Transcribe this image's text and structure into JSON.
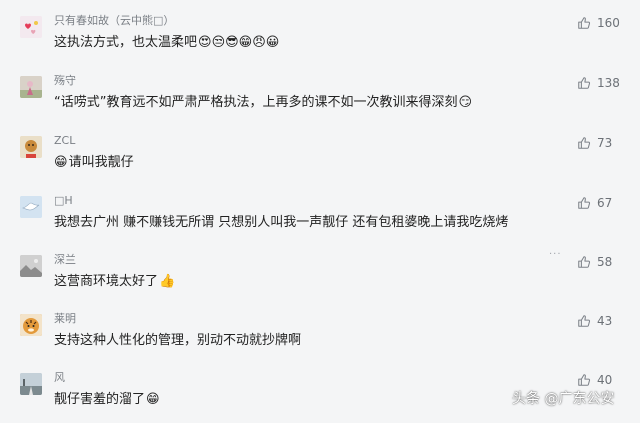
{
  "comments": [
    {
      "user": "只有春如故（云中熊□）",
      "text": "这执法方式，也太温柔吧",
      "emoji": "😍😒😎😁😠😀",
      "likes": "160",
      "avatar_icon": "avatar-hearts-icon",
      "avatar_color": "#f1e7ee"
    },
    {
      "user": "殇守",
      "text": "“话唠式”教育远不如严肃严格执法，上再多的课不如一次教训来得深刻",
      "emoji": "😏",
      "likes": "138",
      "avatar_icon": "avatar-figure-icon",
      "avatar_color": "#d7d0c7"
    },
    {
      "user": "ZCL",
      "text": "请叫我靓仔",
      "emoji": "😁",
      "likes": "73",
      "avatar_icon": "avatar-cartoon-icon",
      "avatar_color": "#e9dcc4"
    },
    {
      "user": "□H",
      "text": "我想去广州 赚不赚钱无所谓 只想别人叫我一声靓仔 还有包租婆晚上请我吃烧烤",
      "emoji": "",
      "likes": "67",
      "avatar_icon": "avatar-bird-icon",
      "avatar_color": "#cfe1f0"
    },
    {
      "user": "深兰",
      "text": "这营商环境太好了",
      "emoji": "👍",
      "likes": "58",
      "avatar_icon": "avatar-landscape-icon",
      "avatar_color": "#c9c9c9"
    },
    {
      "user": "莱明",
      "text": "支持这种人性化的管理，别动不动就抄牌啊",
      "emoji": "",
      "likes": "43",
      "avatar_icon": "avatar-tiger-icon",
      "avatar_color": "#d99a4a"
    },
    {
      "user": "风",
      "text": "靓仔害羞的溜了",
      "emoji": "😁",
      "likes": "40",
      "avatar_icon": "avatar-road-icon",
      "avatar_color": "#b9c6cf"
    }
  ],
  "more_label": "···",
  "watermark": "头条 @广东公安",
  "colors": {
    "background": "#f4f5f6",
    "username": "#7a7f85",
    "text": "#222222",
    "count": "#6c7177"
  }
}
